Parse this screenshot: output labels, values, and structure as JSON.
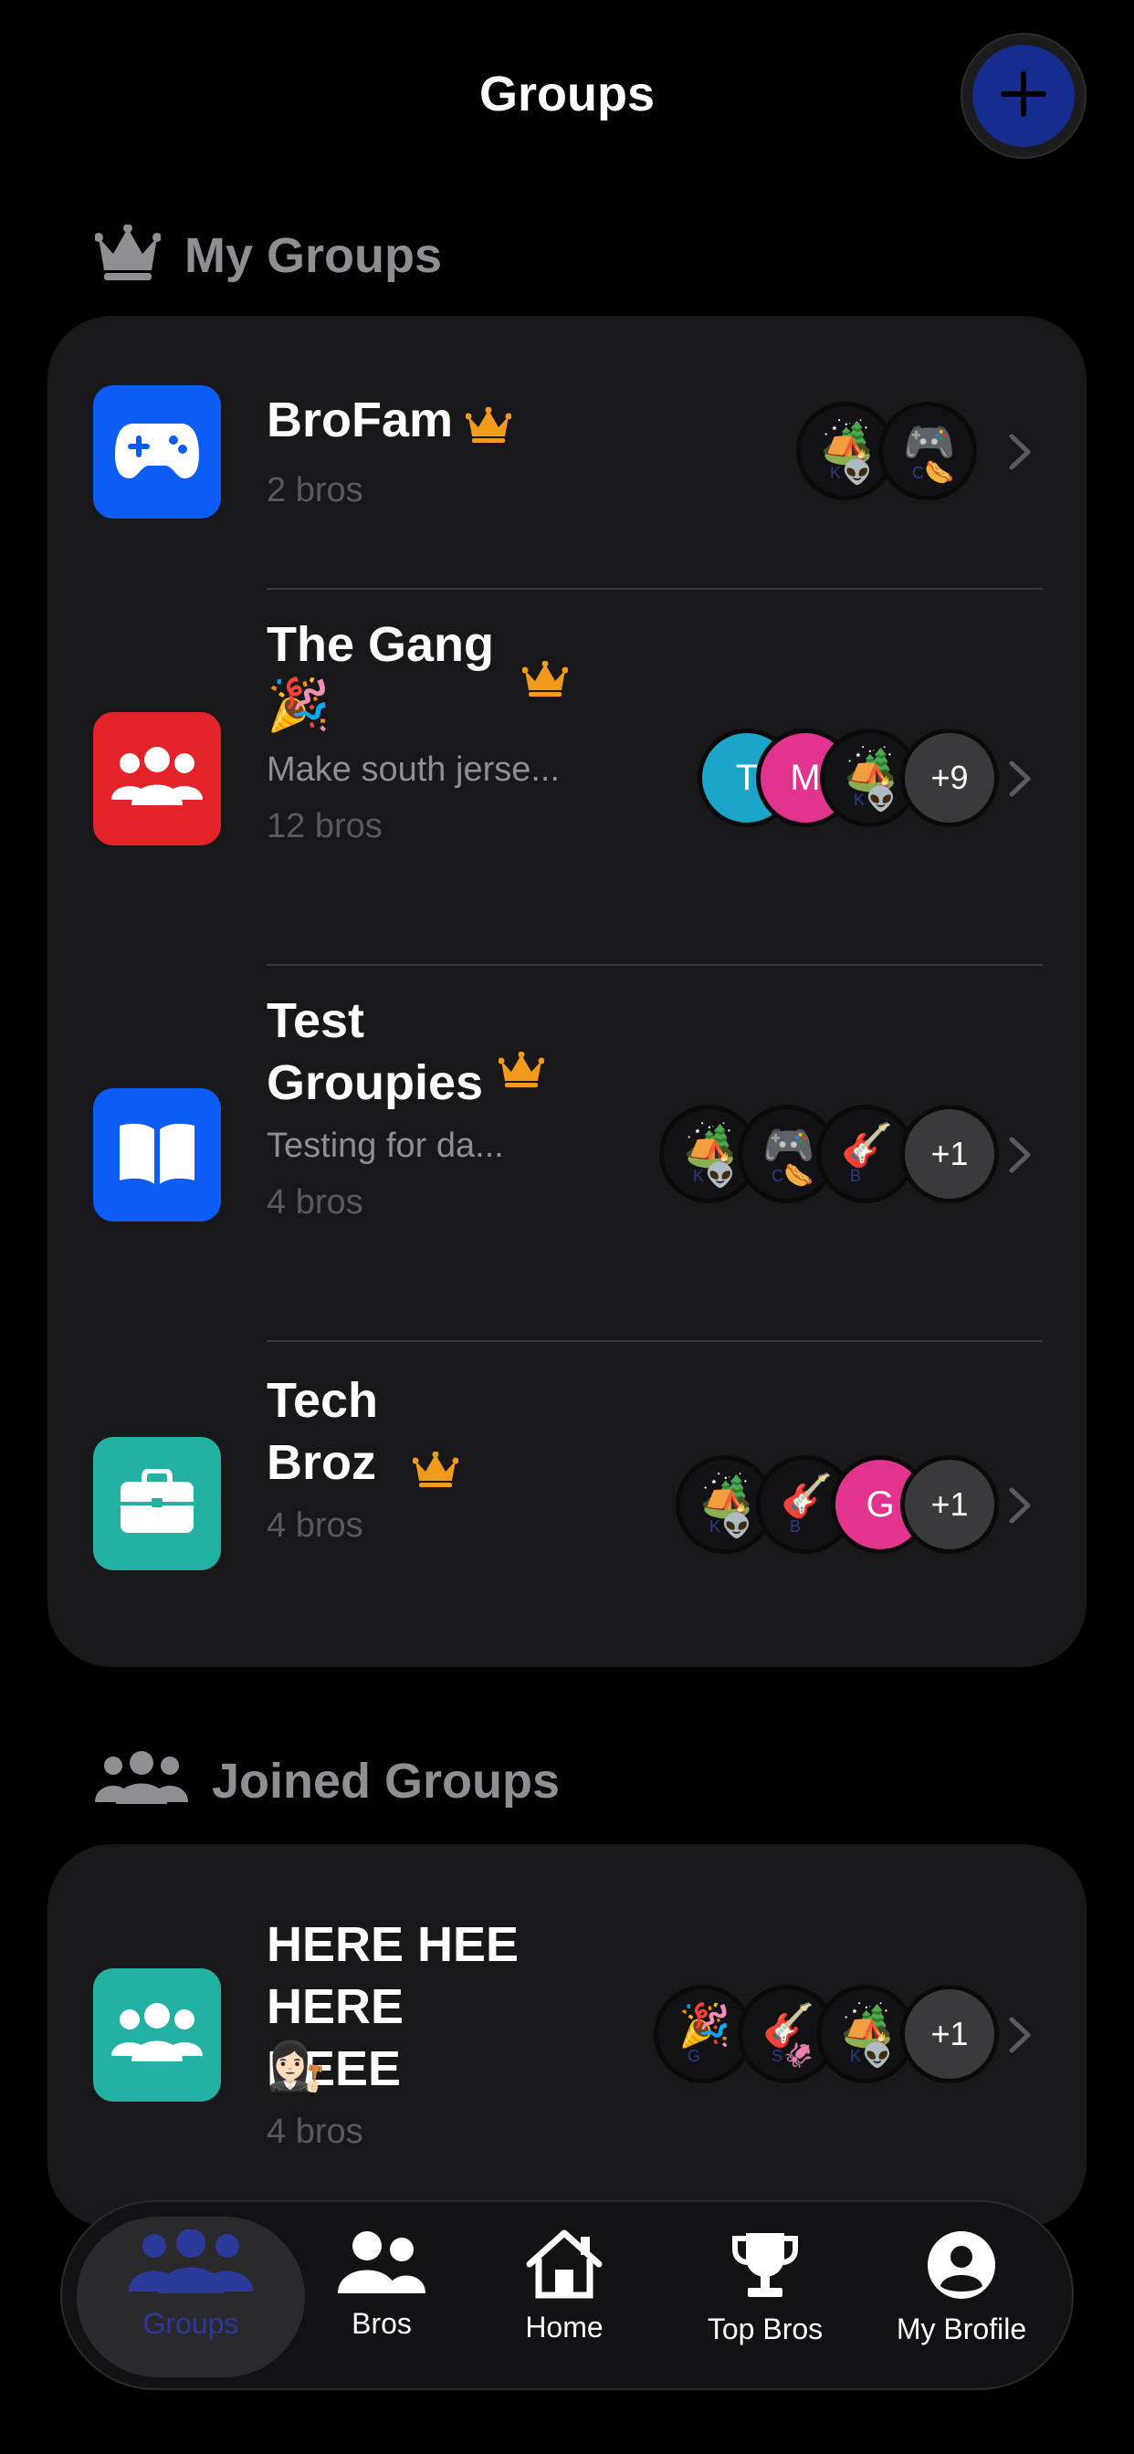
{
  "header": {
    "title": "Groups",
    "add_icon": "plus-icon"
  },
  "sections": {
    "my_groups": {
      "label": "My Groups",
      "icon": "crown-icon"
    },
    "joined_groups": {
      "label": "Joined Groups",
      "icon": "people-icon"
    }
  },
  "my_groups": [
    {
      "name": "BroFam",
      "description": "",
      "count": "2 bros",
      "icon": "gamepad-icon",
      "icon_color": "#0c5cf5",
      "owner": true,
      "avatars": [
        {
          "type": "emoji",
          "emoji": "🏕️",
          "emoji2": "👽",
          "letter": "K"
        },
        {
          "type": "emoji",
          "emoji": "🎮",
          "emoji2": "🌭",
          "letter": "C"
        }
      ]
    },
    {
      "name": "The Gang",
      "emoji": "🎉",
      "description": "Make south jerse...",
      "count": "12 bros",
      "icon": "group-icon",
      "icon_color": "#e42329",
      "owner": true,
      "avatars": [
        {
          "type": "letter",
          "letter": "T",
          "color": "#1aa5c9"
        },
        {
          "type": "letter",
          "letter": "M",
          "color": "#e2338f"
        },
        {
          "type": "emoji",
          "emoji": "🏕️",
          "emoji2": "👽",
          "letter": "K"
        },
        {
          "type": "more",
          "text": "+9"
        }
      ]
    },
    {
      "name": "Test Groupies",
      "description": "Testing for da...",
      "count": "4 bros",
      "icon": "book-icon",
      "icon_color": "#0c5cf5",
      "owner": true,
      "avatars": [
        {
          "type": "emoji",
          "emoji": "🏕️",
          "emoji2": "👽",
          "letter": "K"
        },
        {
          "type": "emoji",
          "emoji": "🎮",
          "emoji2": "🌭",
          "letter": "C"
        },
        {
          "type": "emoji",
          "emoji": "🎸",
          "emoji2": "",
          "letter": "B"
        },
        {
          "type": "more",
          "text": "+1"
        }
      ]
    },
    {
      "name": "Tech Broz",
      "description": "",
      "count": "4 bros",
      "icon": "briefcase-icon",
      "icon_color": "#22b1a3",
      "owner": true,
      "avatars": [
        {
          "type": "emoji",
          "emoji": "🏕️",
          "emoji2": "👽",
          "letter": "K"
        },
        {
          "type": "emoji",
          "emoji": "🎸",
          "emoji2": "",
          "letter": "B"
        },
        {
          "type": "letter",
          "letter": "G",
          "color": "#e2338f"
        },
        {
          "type": "more",
          "text": "+1"
        }
      ]
    }
  ],
  "joined_groups": [
    {
      "name": "HERE HEE HERE HEEE",
      "emoji": "👩🏻‍⚖️",
      "description": "",
      "count": "4 bros",
      "icon": "group-icon",
      "icon_color": "#22b1a3",
      "owner": false,
      "avatars": [
        {
          "type": "emoji",
          "emoji": "🎉",
          "emoji2": "",
          "letter": "G"
        },
        {
          "type": "emoji",
          "emoji": "🎸",
          "emoji2": "🦑",
          "letter": "S"
        },
        {
          "type": "emoji",
          "emoji": "🏕️",
          "emoji2": "👽",
          "letter": "K"
        },
        {
          "type": "more",
          "text": "+1"
        }
      ]
    }
  ],
  "tabbar": [
    {
      "label": "Groups",
      "icon": "groups-icon",
      "active": true
    },
    {
      "label": "Bros",
      "icon": "bros-icon",
      "active": false
    },
    {
      "label": "Home",
      "icon": "home-icon",
      "active": false
    },
    {
      "label": "Top Bros",
      "icon": "trophy-icon",
      "active": false
    },
    {
      "label": "My Brofile",
      "icon": "profile-icon",
      "active": false
    }
  ],
  "colors": {
    "accent": "#162c8e",
    "crown": "#f29a1b",
    "background": "#000000",
    "card": "#18181a"
  }
}
